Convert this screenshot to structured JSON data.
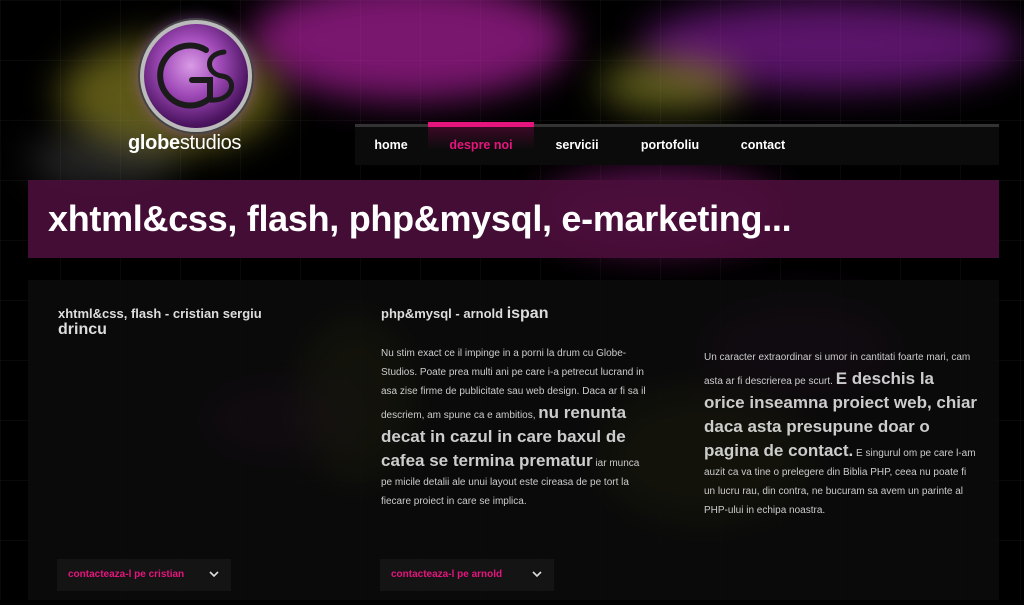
{
  "logo": {
    "text_bold": "globe",
    "text_regular": "studios",
    "emblem": "GS"
  },
  "nav": [
    {
      "label": "home",
      "active": false
    },
    {
      "label": "despre noi",
      "active": true
    },
    {
      "label": "servicii",
      "active": false
    },
    {
      "label": "portofoliu",
      "active": false
    },
    {
      "label": "contact",
      "active": false
    }
  ],
  "banner": {
    "title": "xhtml&css, flash, php&mysql, e-marketing..."
  },
  "columns": [
    {
      "heading_small": "xhtml&css, flash - cristian sergiu",
      "heading_big": "drincu",
      "contact_label": "contacteaza-l pe cristian"
    },
    {
      "heading_small": "php&mysql - arnold",
      "heading_big": "ispan",
      "para_intro": "Nu stim exact ce il impinge in a porni la drum cu Globe-Studios. Poate prea multi ani pe care i-a petrecut lucrand in asa zise firme de publicitate sau web design. Daca ar fi sa il descriem, am spune ca e ambitios,",
      "para_lead": "nu renunta decat in cazul in care baxul de cafea se termina prematur",
      "para_tail": "iar munca pe micile detalii ale unui layout este cireasa de pe tort la fiecare proiect in care se implica.",
      "contact_label": "contacteaza-l pe arnold"
    },
    {
      "para_intro": "Un caracter extraordinar si umor in cantitati foarte mari, cam asta ar fi descrierea pe scurt.",
      "para_lead": "E deschis la orice inseamna proiect web, chiar daca asta presupune doar o pagina de contact.",
      "para_tail": "E singurul om pe care l-am auzit ca va tine o prelegere din Biblia PHP, ceea nu poate fi un lucru rau, din contra, ne bucuram sa avem un parinte al PHP-ului in echipa noastra."
    }
  ],
  "colors": {
    "accent": "#e6157e",
    "banner": "#4a0e3a",
    "background": "#000000"
  },
  "icons": {
    "chevron": "chevron-down-icon"
  }
}
